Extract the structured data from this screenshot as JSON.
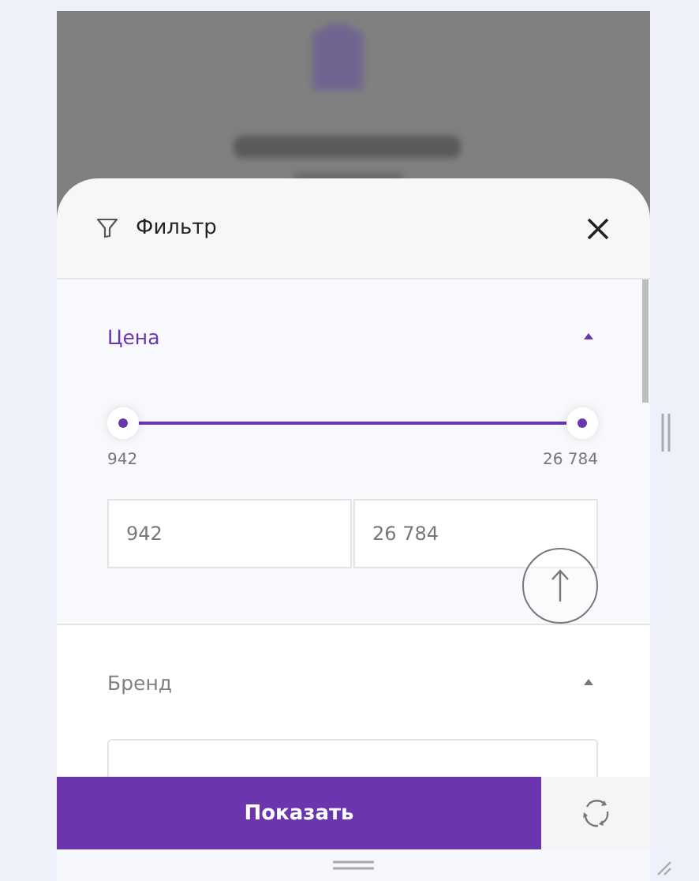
{
  "filter_panel": {
    "title": "Фильтр",
    "sections": [
      {
        "kind": "range",
        "title": "Цена",
        "active": true,
        "expanded": true,
        "min_label": "942",
        "max_label": "26 784",
        "low": {
          "level": 0
        },
        "high": {
          "level": 1
        },
        "from_value": "942",
        "to_value": "26 784"
      },
      {
        "kind": "search",
        "title": "Бренд",
        "active": false,
        "expanded": true
      }
    ],
    "show_button": "Показать"
  }
}
